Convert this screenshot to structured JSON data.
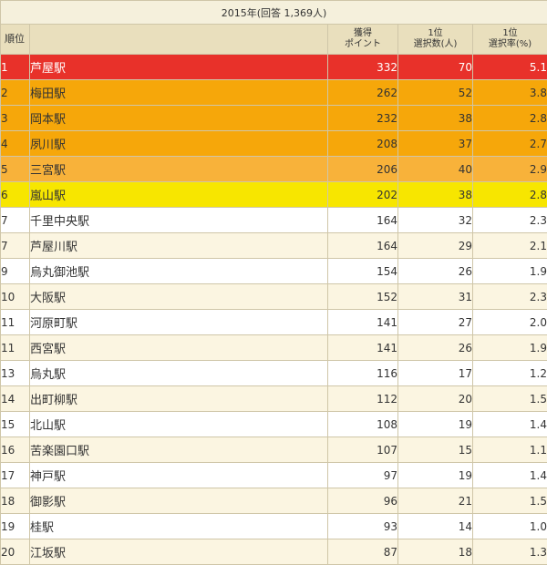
{
  "caption": "2015年(回答 1,369人)",
  "headers": {
    "rank": "順位",
    "name": "",
    "points": [
      "獲得",
      "ポイント"
    ],
    "first_count": [
      "1位",
      "選択数(人)"
    ],
    "first_rate": [
      "1位",
      "選択率(%)"
    ]
  },
  "colors": {
    "rank1": "#e8312a",
    "rank2_4": "#f6a70a",
    "rank5": "#f8b23a",
    "rank6": "#f7e600",
    "header": "#e9dfbd",
    "stripe": "#fbf5e1"
  },
  "rows": [
    {
      "rank": "1",
      "name": "芦屋駅",
      "points": "332",
      "first_count": "70",
      "first_rate": "5.1"
    },
    {
      "rank": "2",
      "name": "梅田駅",
      "points": "262",
      "first_count": "52",
      "first_rate": "3.8"
    },
    {
      "rank": "3",
      "name": "岡本駅",
      "points": "232",
      "first_count": "38",
      "first_rate": "2.8"
    },
    {
      "rank": "4",
      "name": "夙川駅",
      "points": "208",
      "first_count": "37",
      "first_rate": "2.7"
    },
    {
      "rank": "5",
      "name": "三宮駅",
      "points": "206",
      "first_count": "40",
      "first_rate": "2.9"
    },
    {
      "rank": "6",
      "name": "嵐山駅",
      "points": "202",
      "first_count": "38",
      "first_rate": "2.8"
    },
    {
      "rank": "7",
      "name": "千里中央駅",
      "points": "164",
      "first_count": "32",
      "first_rate": "2.3"
    },
    {
      "rank": "7",
      "name": "芦屋川駅",
      "points": "164",
      "first_count": "29",
      "first_rate": "2.1"
    },
    {
      "rank": "9",
      "name": "烏丸御池駅",
      "points": "154",
      "first_count": "26",
      "first_rate": "1.9"
    },
    {
      "rank": "10",
      "name": "大阪駅",
      "points": "152",
      "first_count": "31",
      "first_rate": "2.3"
    },
    {
      "rank": "11",
      "name": "河原町駅",
      "points": "141",
      "first_count": "27",
      "first_rate": "2.0"
    },
    {
      "rank": "11",
      "name": "西宮駅",
      "points": "141",
      "first_count": "26",
      "first_rate": "1.9"
    },
    {
      "rank": "13",
      "name": "烏丸駅",
      "points": "116",
      "first_count": "17",
      "first_rate": "1.2"
    },
    {
      "rank": "14",
      "name": "出町柳駅",
      "points": "112",
      "first_count": "20",
      "first_rate": "1.5"
    },
    {
      "rank": "15",
      "name": "北山駅",
      "points": "108",
      "first_count": "19",
      "first_rate": "1.4"
    },
    {
      "rank": "16",
      "name": "苦楽園口駅",
      "points": "107",
      "first_count": "15",
      "first_rate": "1.1"
    },
    {
      "rank": "17",
      "name": "神戸駅",
      "points": "97",
      "first_count": "19",
      "first_rate": "1.4"
    },
    {
      "rank": "18",
      "name": "御影駅",
      "points": "96",
      "first_count": "21",
      "first_rate": "1.5"
    },
    {
      "rank": "19",
      "name": "桂駅",
      "points": "93",
      "first_count": "14",
      "first_rate": "1.0"
    },
    {
      "rank": "20",
      "name": "江坂駅",
      "points": "87",
      "first_count": "18",
      "first_rate": "1.3"
    }
  ]
}
